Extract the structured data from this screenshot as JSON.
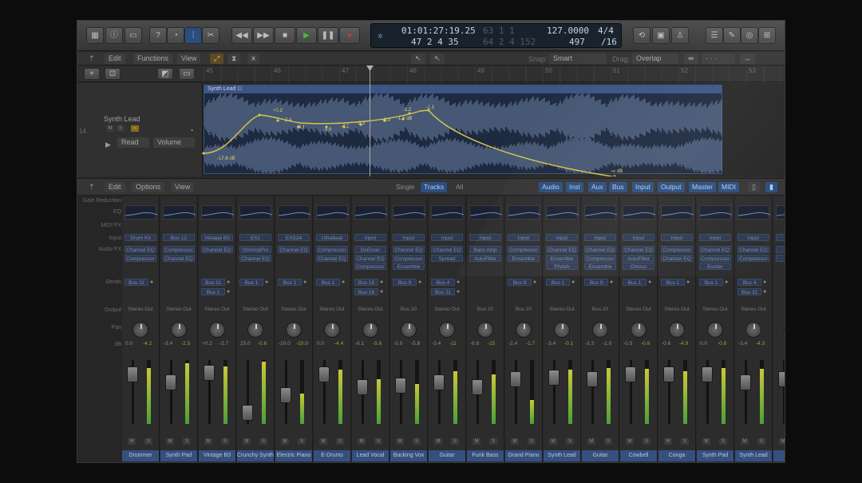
{
  "transport": {
    "time": "01:01:27:19.25",
    "time_dim": "63 1 1",
    "bars": "47 2 4 35",
    "bars_dim": "64 2 4 152",
    "tempo": "127.0000",
    "tempo_sub": "497",
    "sig": "4/4",
    "div": "/16"
  },
  "tracks_toolbar": {
    "edit": "Edit",
    "functions": "Functions",
    "view": "View",
    "snap_label": "Snap:",
    "snap_value": "Smart",
    "drag_label": "Drag:",
    "drag_value": "Overlap"
  },
  "ruler": [
    "45",
    "46",
    "47",
    "48",
    "49",
    "50",
    "51",
    "52",
    "53"
  ],
  "track": {
    "number": "14",
    "name": "Synth Lead",
    "mode": "Read",
    "param": "Volume",
    "region_name": "Synth Lead",
    "auto_labels": [
      "-17.6 dB",
      "+0.2",
      "-2.4",
      "-5.1",
      "-3.0",
      "-4.1",
      "-3.3",
      "-2.0",
      "-1.4 dB",
      "-1.2",
      "-1.1",
      "-∞ dB"
    ]
  },
  "mixer_toolbar": {
    "edit": "Edit",
    "options": "Options",
    "view": "View",
    "modes": [
      "Single",
      "Tracks",
      "All"
    ],
    "active_mode": "Tracks",
    "filters": [
      "Audio",
      "Inst",
      "Aux",
      "Bus",
      "Input",
      "Output",
      "Master",
      "MIDI"
    ]
  },
  "row_labels": {
    "gain": "Gain Reduction",
    "eq": "EQ",
    "midifx": "MIDI FX",
    "input": "Input",
    "audiofx": "Audio FX",
    "sends": "Sends",
    "output": "Output",
    "pan": "Pan",
    "db": "dB"
  },
  "strips": [
    {
      "name": "Drummer",
      "input": "Drum Kit",
      "fx": [
        "Channel EQ",
        "Compressor"
      ],
      "sends": [
        "Bus 11"
      ],
      "output": "Stereo Out",
      "db1": "0.0",
      "db2": "-4.2",
      "fader": 0.78,
      "meter": 0.88
    },
    {
      "name": "Synth Pad",
      "input": "Bus 12",
      "fx": [
        "Compressor",
        "Channel EQ"
      ],
      "sends": [],
      "output": "Stereo Out",
      "db1": "-3.4",
      "db2": "-2.5",
      "fader": 0.65,
      "meter": 0.95
    },
    {
      "name": "Vintage B3",
      "input": "Vintage B3",
      "fx": [
        "Channel EQ"
      ],
      "sends": [
        "Bus 11",
        "Bus 1"
      ],
      "output": "Stereo Out",
      "db1": "+0.2",
      "db2": "-2.7",
      "fader": 0.8,
      "meter": 0.9
    },
    {
      "name": "Crunchy Synth",
      "input": "ES1",
      "fx": [
        "GtrAmpPro",
        "Channel EQ"
      ],
      "sends": [
        "Bus 1"
      ],
      "output": "Stereo Out",
      "db1": "25.0",
      "db2": "-0.6",
      "fader": 0.18,
      "meter": 0.98
    },
    {
      "name": "Electric Piano",
      "input": "EXS24",
      "fx": [
        "Channel EQ"
      ],
      "sends": [
        "Bus 1"
      ],
      "output": "Stereo Out",
      "db1": "-10.0",
      "db2": "-10.0",
      "fader": 0.45,
      "meter": 0.48
    },
    {
      "name": "E-Drums",
      "input": "Ultrabeat",
      "fx": [
        "Compressor",
        "Channel EQ"
      ],
      "sends": [
        "Bus 1"
      ],
      "output": "Stereo Out",
      "db1": "0.0",
      "db2": "-4.4",
      "fader": 0.78,
      "meter": 0.85
    },
    {
      "name": "Lead Vocal",
      "input": "Input",
      "fx": [
        "DeEsser",
        "Channel EQ",
        "Compressor"
      ],
      "sends": [
        "Bus 15",
        "Bus 16"
      ],
      "output": "Stereo Out",
      "db1": "-6.1",
      "db2": "-5.6",
      "fader": 0.58,
      "meter": 0.7
    },
    {
      "name": "Backing Vox",
      "input": "Input",
      "fx": [
        "Channel EQ",
        "Compressor",
        "Ensemble"
      ],
      "sends": [
        "Bus 9"
      ],
      "output": "Bus 20",
      "db1": "-5.9",
      "db2": "-5.8",
      "fader": 0.6,
      "meter": 0.62
    },
    {
      "name": "Guitar",
      "input": "Input",
      "fx": [
        "Channel EQ",
        "Spread"
      ],
      "sends": [
        "Bus 4",
        "Bus 11"
      ],
      "output": "Stereo Out",
      "db1": "-3.4",
      "db2": "-11",
      "fader": 0.65,
      "meter": 0.82
    },
    {
      "name": "Funk Bass",
      "input": "Input",
      "fx": [
        "Bass Amp",
        "AutoFilter"
      ],
      "sends": [],
      "output": "Bus 20",
      "db1": "-6.8",
      "db2": "-15",
      "fader": 0.58,
      "meter": 0.78
    },
    {
      "name": "Grand Piano",
      "input": "Input",
      "fx": [
        "Compressor",
        "Ensemble"
      ],
      "sends": [
        "Bus 9"
      ],
      "output": "Bus 20",
      "db1": "-2.4",
      "db2": "-1.7",
      "fader": 0.7,
      "meter": 0.38
    },
    {
      "name": "Synth Lead",
      "input": "Input",
      "fx": [
        "Channel EQ",
        "Ensemble",
        "PtVerb"
      ],
      "sends": [
        "Bus 1"
      ],
      "output": "Stereo Out",
      "db1": "-3.4",
      "db2": "-0.1",
      "fader": 0.72,
      "meter": 0.85
    },
    {
      "name": "Guitar",
      "input": "Input",
      "fx": [
        "Channel EQ",
        "Compressor",
        "Ensemble"
      ],
      "sends": [
        "Bus 9"
      ],
      "output": "Bus 20",
      "db1": "-3.3",
      "db2": "-1.0",
      "fader": 0.7,
      "meter": 0.88
    },
    {
      "name": "Cowbell",
      "input": "Input",
      "fx": [
        "Channel EQ",
        "AutoFilter",
        "Chorus"
      ],
      "sends": [
        "Bus 1"
      ],
      "output": "Stereo Out",
      "db1": "-0.5",
      "db2": "-0.8",
      "fader": 0.78,
      "meter": 0.86
    },
    {
      "name": "Conga",
      "input": "Input",
      "fx": [
        "Compressor",
        "Channel EQ"
      ],
      "sends": [
        "Bus 1"
      ],
      "output": "Stereo Out",
      "db1": "-0.6",
      "db2": "-4.9",
      "fader": 0.78,
      "meter": 0.82
    },
    {
      "name": "Synth Pad",
      "input": "Input",
      "fx": [
        "Channel EQ",
        "Compressor",
        "Exciter"
      ],
      "sends": [
        "Bus 1"
      ],
      "output": "Stereo Out",
      "db1": "0.0",
      "db2": "-0.8",
      "fader": 0.78,
      "meter": 0.88
    },
    {
      "name": "Synth Lead",
      "input": "Input",
      "fx": [
        "Channel EQ",
        "Compressor"
      ],
      "sends": [
        "Bus 4",
        "Bus 11"
      ],
      "output": "Stereo Out",
      "db1": "-3.4",
      "db2": "-4.3",
      "fader": 0.65,
      "meter": 0.86
    },
    {
      "name": "Vo",
      "input": "I",
      "fx": [
        "C",
        "C"
      ],
      "sends": [],
      "output": "S",
      "db1": "",
      "db2": "",
      "fader": 0.7,
      "meter": 0.6
    }
  ],
  "colors": {
    "accent": "#3c5585",
    "meter_green": "#4aa03a",
    "automation": "#d8c64a",
    "play": "#2f8f2f"
  }
}
